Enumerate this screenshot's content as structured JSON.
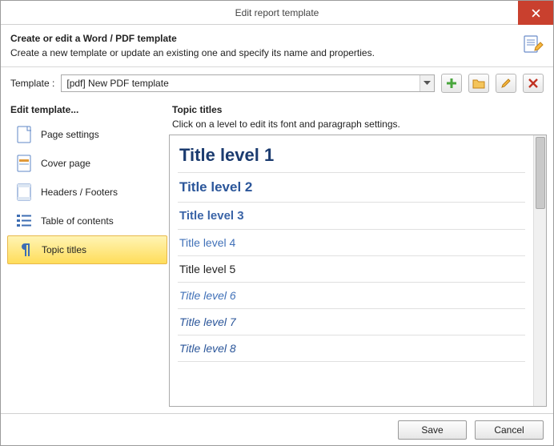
{
  "window": {
    "title": "Edit report template"
  },
  "header": {
    "title": "Create or edit a Word / PDF template",
    "subtitle": "Create a new template or update an existing one and specify its name and properties."
  },
  "template_row": {
    "label": "Template :",
    "selected": "[pdf] New PDF template"
  },
  "sidebar": {
    "title": "Edit template...",
    "items": [
      {
        "label": "Page settings"
      },
      {
        "label": "Cover page"
      },
      {
        "label": "Headers / Footers"
      },
      {
        "label": "Table of contents"
      },
      {
        "label": "Topic titles"
      }
    ]
  },
  "right": {
    "title": "Topic titles",
    "hint": "Click on a level to edit its font and paragraph settings.",
    "levels": [
      "Title level 1",
      "Title level 2",
      "Title level 3",
      "Title level 4",
      "Title level 5",
      "Title level 6",
      "Title level 7",
      "Title level 8"
    ]
  },
  "footer": {
    "save": "Save",
    "cancel": "Cancel"
  }
}
